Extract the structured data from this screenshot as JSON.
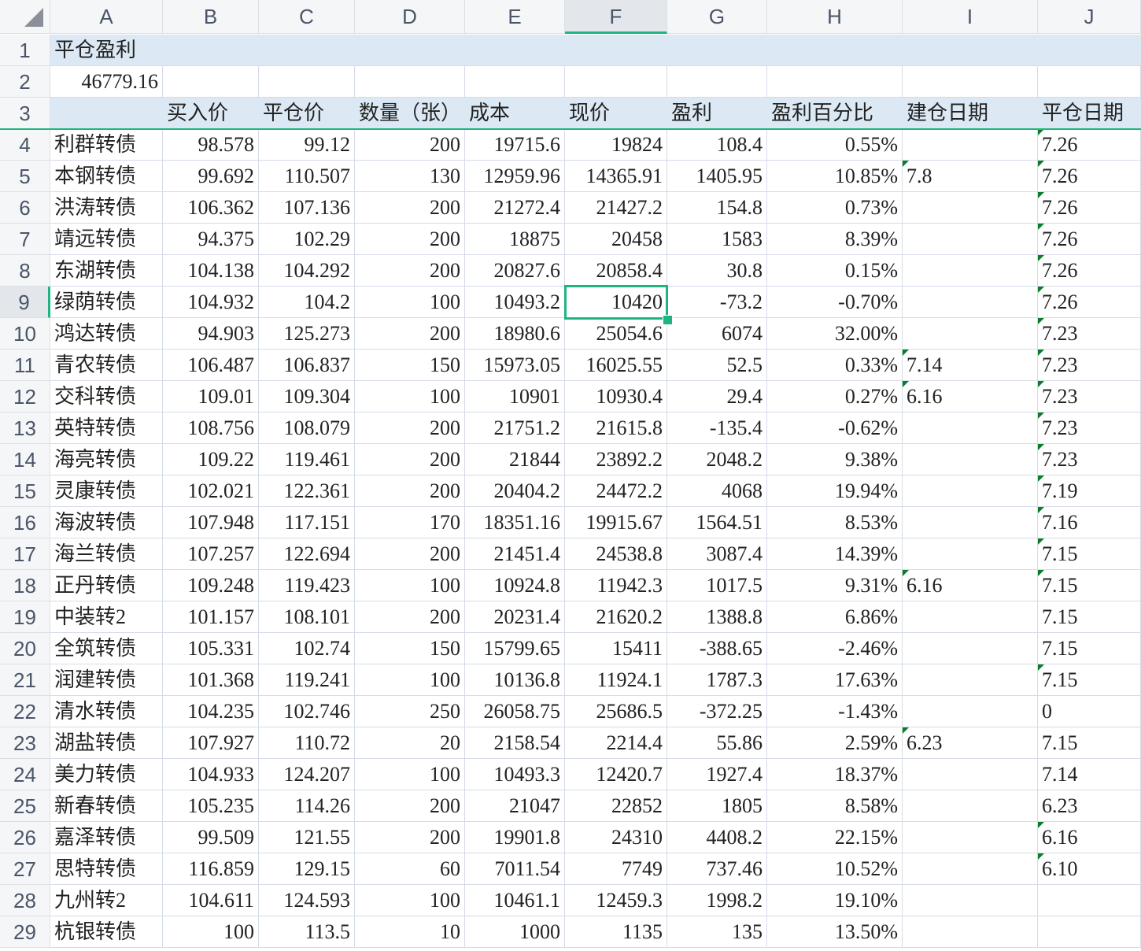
{
  "columns": [
    "A",
    "B",
    "C",
    "D",
    "E",
    "F",
    "G",
    "H",
    "I",
    "J"
  ],
  "selected_cell": "F9",
  "title": "平仓盈利",
  "total": "46779.16",
  "headers": [
    "",
    "买入价",
    "平仓价",
    "数量（张）",
    "成本",
    "现价",
    "盈利",
    "盈利百分比",
    "建仓日期",
    "平仓日期"
  ],
  "rows": [
    [
      "利群转债",
      "98.578",
      "99.12",
      "200",
      "19715.6",
      "19824",
      "108.4",
      "0.55%",
      "",
      "7.26"
    ],
    [
      "本钢转债",
      "99.692",
      "110.507",
      "130",
      "12959.96",
      "14365.91",
      "1405.95",
      "10.85%",
      "7.8",
      "7.26"
    ],
    [
      "洪涛转债",
      "106.362",
      "107.136",
      "200",
      "21272.4",
      "21427.2",
      "154.8",
      "0.73%",
      "",
      "7.26"
    ],
    [
      "靖远转债",
      "94.375",
      "102.29",
      "200",
      "18875",
      "20458",
      "1583",
      "8.39%",
      "",
      "7.26"
    ],
    [
      "东湖转债",
      "104.138",
      "104.292",
      "200",
      "20827.6",
      "20858.4",
      "30.8",
      "0.15%",
      "",
      "7.26"
    ],
    [
      "绿荫转债",
      "104.932",
      "104.2",
      "100",
      "10493.2",
      "10420",
      "-73.2",
      "-0.70%",
      "",
      "7.26"
    ],
    [
      "鸿达转债",
      "94.903",
      "125.273",
      "200",
      "18980.6",
      "25054.6",
      "6074",
      "32.00%",
      "",
      "7.23"
    ],
    [
      "青农转债",
      "106.487",
      "106.837",
      "150",
      "15973.05",
      "16025.55",
      "52.5",
      "0.33%",
      "7.14",
      "7.23"
    ],
    [
      "交科转债",
      "109.01",
      "109.304",
      "100",
      "10901",
      "10930.4",
      "29.4",
      "0.27%",
      "6.16",
      "7.23"
    ],
    [
      "英特转债",
      "108.756",
      "108.079",
      "200",
      "21751.2",
      "21615.8",
      "-135.4",
      "-0.62%",
      "",
      "7.23"
    ],
    [
      "海亮转债",
      "109.22",
      "119.461",
      "200",
      "21844",
      "23892.2",
      "2048.2",
      "9.38%",
      "",
      "7.23"
    ],
    [
      "灵康转债",
      "102.021",
      "122.361",
      "200",
      "20404.2",
      "24472.2",
      "4068",
      "19.94%",
      "",
      "7.19"
    ],
    [
      "海波转债",
      "107.948",
      "117.151",
      "170",
      "18351.16",
      "19915.67",
      "1564.51",
      "8.53%",
      "",
      "7.16"
    ],
    [
      "海兰转债",
      "107.257",
      "122.694",
      "200",
      "21451.4",
      "24538.8",
      "3087.4",
      "14.39%",
      "",
      "7.15"
    ],
    [
      "正丹转债",
      "109.248",
      "119.423",
      "100",
      "10924.8",
      "11942.3",
      "1017.5",
      "9.31%",
      "6.16",
      "7.15"
    ],
    [
      "中装转2",
      "101.157",
      "108.101",
      "200",
      "20231.4",
      "21620.2",
      "1388.8",
      "6.86%",
      "",
      "7.15"
    ],
    [
      "全筑转债",
      "105.331",
      "102.74",
      "150",
      "15799.65",
      "15411",
      "-388.65",
      "-2.46%",
      "",
      "7.15"
    ],
    [
      "润建转债",
      "101.368",
      "119.241",
      "100",
      "10136.8",
      "11924.1",
      "1787.3",
      "17.63%",
      "",
      "7.15"
    ],
    [
      "清水转债",
      "104.235",
      "102.746",
      "250",
      "26058.75",
      "25686.5",
      "-372.25",
      "-1.43%",
      "",
      "0"
    ],
    [
      "湖盐转债",
      "107.927",
      "110.72",
      "20",
      "2158.54",
      "2214.4",
      "55.86",
      "2.59%",
      "6.23",
      "7.15"
    ],
    [
      "美力转债",
      "104.933",
      "124.207",
      "100",
      "10493.3",
      "12420.7",
      "1927.4",
      "18.37%",
      "",
      "7.14"
    ],
    [
      "新春转债",
      "105.235",
      "114.26",
      "200",
      "21047",
      "22852",
      "1805",
      "8.58%",
      "",
      "6.23"
    ],
    [
      "嘉泽转债",
      "99.509",
      "121.55",
      "200",
      "19901.8",
      "24310",
      "4408.2",
      "22.15%",
      "",
      "6.16"
    ],
    [
      "思特转债",
      "116.859",
      "129.15",
      "60",
      "7011.54",
      "7749",
      "737.46",
      "10.52%",
      "",
      "6.10"
    ],
    [
      "九州转2",
      "104.611",
      "124.593",
      "100",
      "10461.1",
      "12459.3",
      "1998.2",
      "19.10%",
      "",
      ""
    ],
    [
      "杭银转债",
      "100",
      "113.5",
      "10",
      "1000",
      "1135",
      "135",
      "13.50%",
      "",
      ""
    ]
  ],
  "text_flags": [
    "I5",
    "I11",
    "I12",
    "I18",
    "I23",
    "J4",
    "J5",
    "J6",
    "J7",
    "J8",
    "J9",
    "J10",
    "J11",
    "J12",
    "J13",
    "J14",
    "J15",
    "J16",
    "J17",
    "J18",
    "J21",
    "J26",
    "J27"
  ],
  "colors": {
    "accent": "#1fb57f",
    "header_band": "#dce9f5",
    "flag": "#0a7d2c"
  }
}
